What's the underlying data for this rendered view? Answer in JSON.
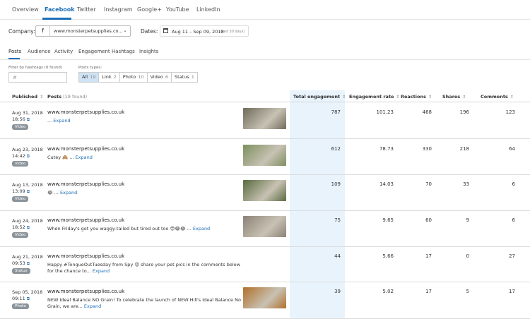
{
  "nav": {
    "tabs": [
      "Overview",
      "Facebook",
      "Twitter",
      "Instagram",
      "Google+",
      "YouTube",
      "LinkedIn"
    ],
    "active": "Facebook"
  },
  "filters": {
    "company_label": "Company:",
    "company_icon": "f",
    "company_value": "www.monsterpetsupplies.co...",
    "dates_label": "Dates:",
    "date_range": "Aug 11 – Sep 09, 2018",
    "date_sub": "(last 30 days)"
  },
  "subtabs": [
    "Posts",
    "Audience",
    "Activity",
    "Engagement",
    "Hashtags",
    "Insights"
  ],
  "hashtag_filter": {
    "label": "Filter by hashtags (0 found)",
    "placeholder": "#"
  },
  "post_types": {
    "label": "Posts types:",
    "items": [
      {
        "label": "All",
        "count": "19"
      },
      {
        "label": "Link",
        "count": "2"
      },
      {
        "label": "Photo",
        "count": "10"
      },
      {
        "label": "Video",
        "count": "6"
      },
      {
        "label": "Status",
        "count": "1"
      }
    ]
  },
  "table": {
    "headers": {
      "published": "Published",
      "posts": "Posts",
      "posts_count": "(19 found)",
      "total_engagement": "Total engagement",
      "engagement_rate": "Engagement rate",
      "reactions": "Reactions",
      "shares": "Shares",
      "comments": "Comments"
    },
    "expand_label": "Expand",
    "rows": [
      {
        "date": "Aug 31, 2018",
        "time": "18:56",
        "type": "Video",
        "account": "www.monsterpetsupplies.co.uk",
        "message": "... ",
        "total": "787",
        "rate": "101.23",
        "reactions": "468",
        "shares": "196",
        "comments": "123",
        "thumb_color": "#6f6a5a"
      },
      {
        "date": "Aug 23, 2018",
        "time": "14:42",
        "type": "Video",
        "account": "www.monsterpetsupplies.co.uk",
        "message": "Cutey 🙈 ... ",
        "total": "612",
        "rate": "78.73",
        "reactions": "330",
        "shares": "218",
        "comments": "64",
        "thumb_color": "#7d8f5e"
      },
      {
        "date": "Aug 13, 2018",
        "time": "13:09",
        "type": "Video",
        "account": "www.monsterpetsupplies.co.uk",
        "message": "😂 ... ",
        "total": "109",
        "rate": "14.03",
        "reactions": "70",
        "shares": "33",
        "comments": "6",
        "thumb_color": "#5a6b3e"
      },
      {
        "date": "Aug 24, 2018",
        "time": "18:52",
        "type": "Video",
        "account": "www.monsterpetsupplies.co.uk",
        "message": "When Friday's got you waggy-tailed but tired out too 😍😂😂 ... ",
        "total": "75",
        "rate": "9.65",
        "reactions": "60",
        "shares": "9",
        "comments": "6",
        "thumb_color": "#8b8276"
      },
      {
        "date": "Aug 21, 2018",
        "time": "09:53",
        "type": "Status",
        "account": "www.monsterpetsupplies.co.uk",
        "message": "Happy #TongueOutTuesday from Spy 😜 share your pet pics in the comments below for the chance to... ",
        "total": "44",
        "rate": "5.66",
        "reactions": "17",
        "shares": "0",
        "comments": "27",
        "thumb_color": ""
      },
      {
        "date": "Sep 05, 2018",
        "time": "09:11",
        "type": "Photo",
        "account": "www.monsterpetsupplies.co.uk",
        "message": "NEW Ideal Balance NO Grain! To celebrate the launch of NEW Hill's Ideal Balance No Grain, we are... ",
        "total": "39",
        "rate": "5.02",
        "reactions": "17",
        "shares": "5",
        "comments": "17",
        "thumb_color": "#b0702a"
      }
    ]
  }
}
